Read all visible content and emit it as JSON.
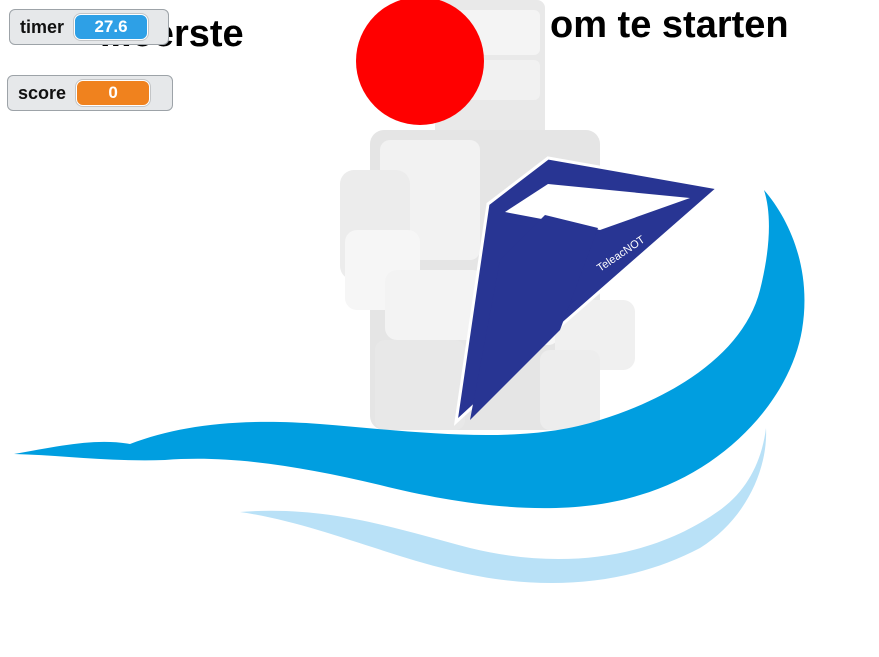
{
  "instructions": {
    "left_text": "...eerste",
    "right_text": "om te starten"
  },
  "monitors": {
    "timer": {
      "label": "timer",
      "value": "27.6",
      "color": "#2ea0e6"
    },
    "score": {
      "label": "score",
      "value": "0",
      "color": "#f0821e"
    }
  },
  "sprites": {
    "ball_color": "#ff0000",
    "wave_dark_color": "#009ee0",
    "wave_light_color": "#b9e1f7",
    "logo_color": "#283593",
    "logo_text": "TeleacNOT"
  }
}
